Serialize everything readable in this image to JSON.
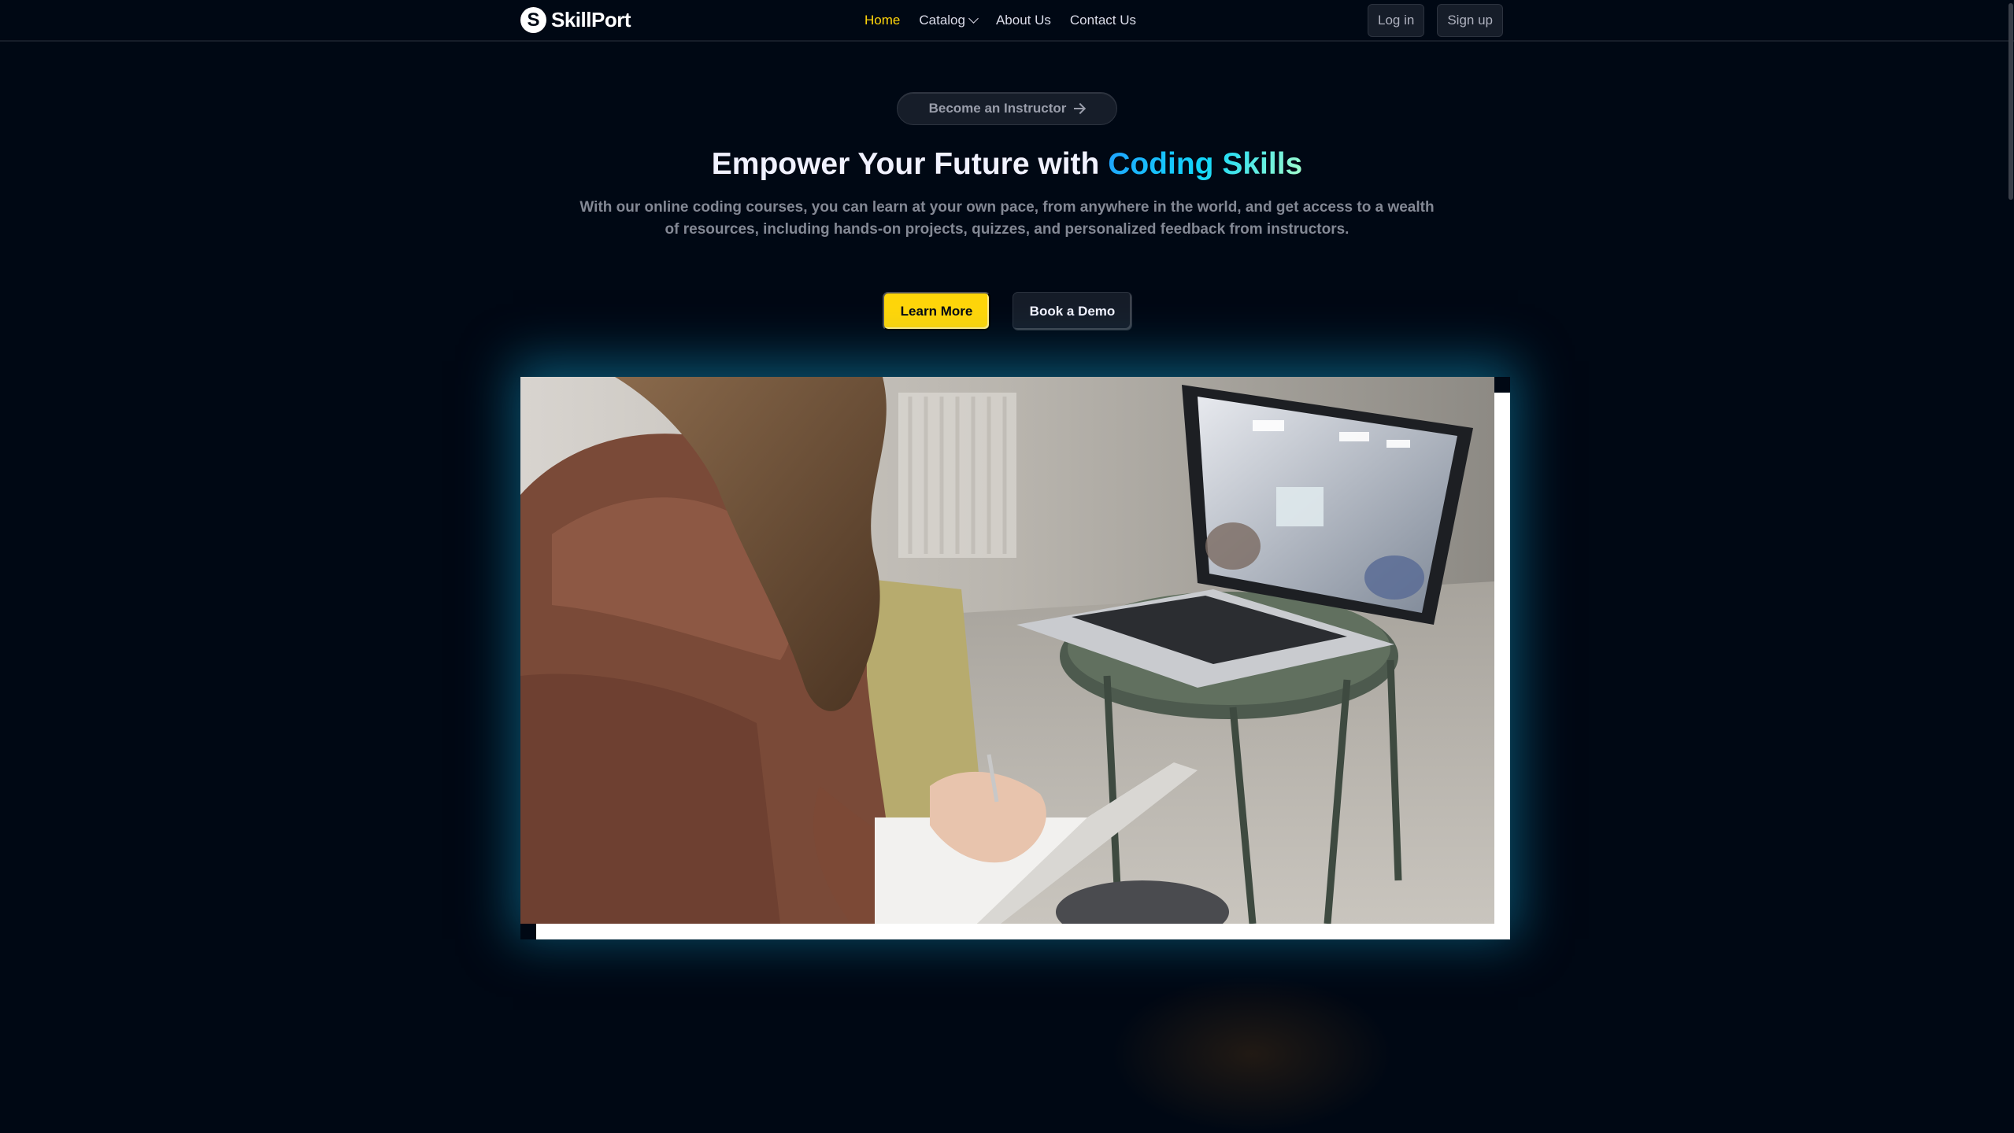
{
  "brand": {
    "name": "SkillPort",
    "mark": "S"
  },
  "nav": {
    "links": {
      "home": "Home",
      "catalog": "Catalog",
      "about": "About Us",
      "contact": "Contact Us"
    },
    "login": "Log in",
    "signup": "Sign up",
    "catalog_icon": "chevron-down-icon"
  },
  "hero": {
    "instructor_pill": "Become an Instructor",
    "instructor_icon": "arrow-right-icon",
    "headline_prefix": "Empower Your Future with ",
    "headline_highlight": "Coding Skills",
    "subtext": "With our online coding courses, you can learn at your own pace, from anywhere in the world, and get access to a wealth of resources, including hands-on projects, quizzes, and personalized feedback from instructors.",
    "cta_primary": "Learn More",
    "cta_secondary": "Book a Demo"
  },
  "colors": {
    "background": "#000814",
    "accent_yellow": "#ffd60a",
    "highlight_blue": "#12d8fa",
    "panel": "#161d29"
  }
}
